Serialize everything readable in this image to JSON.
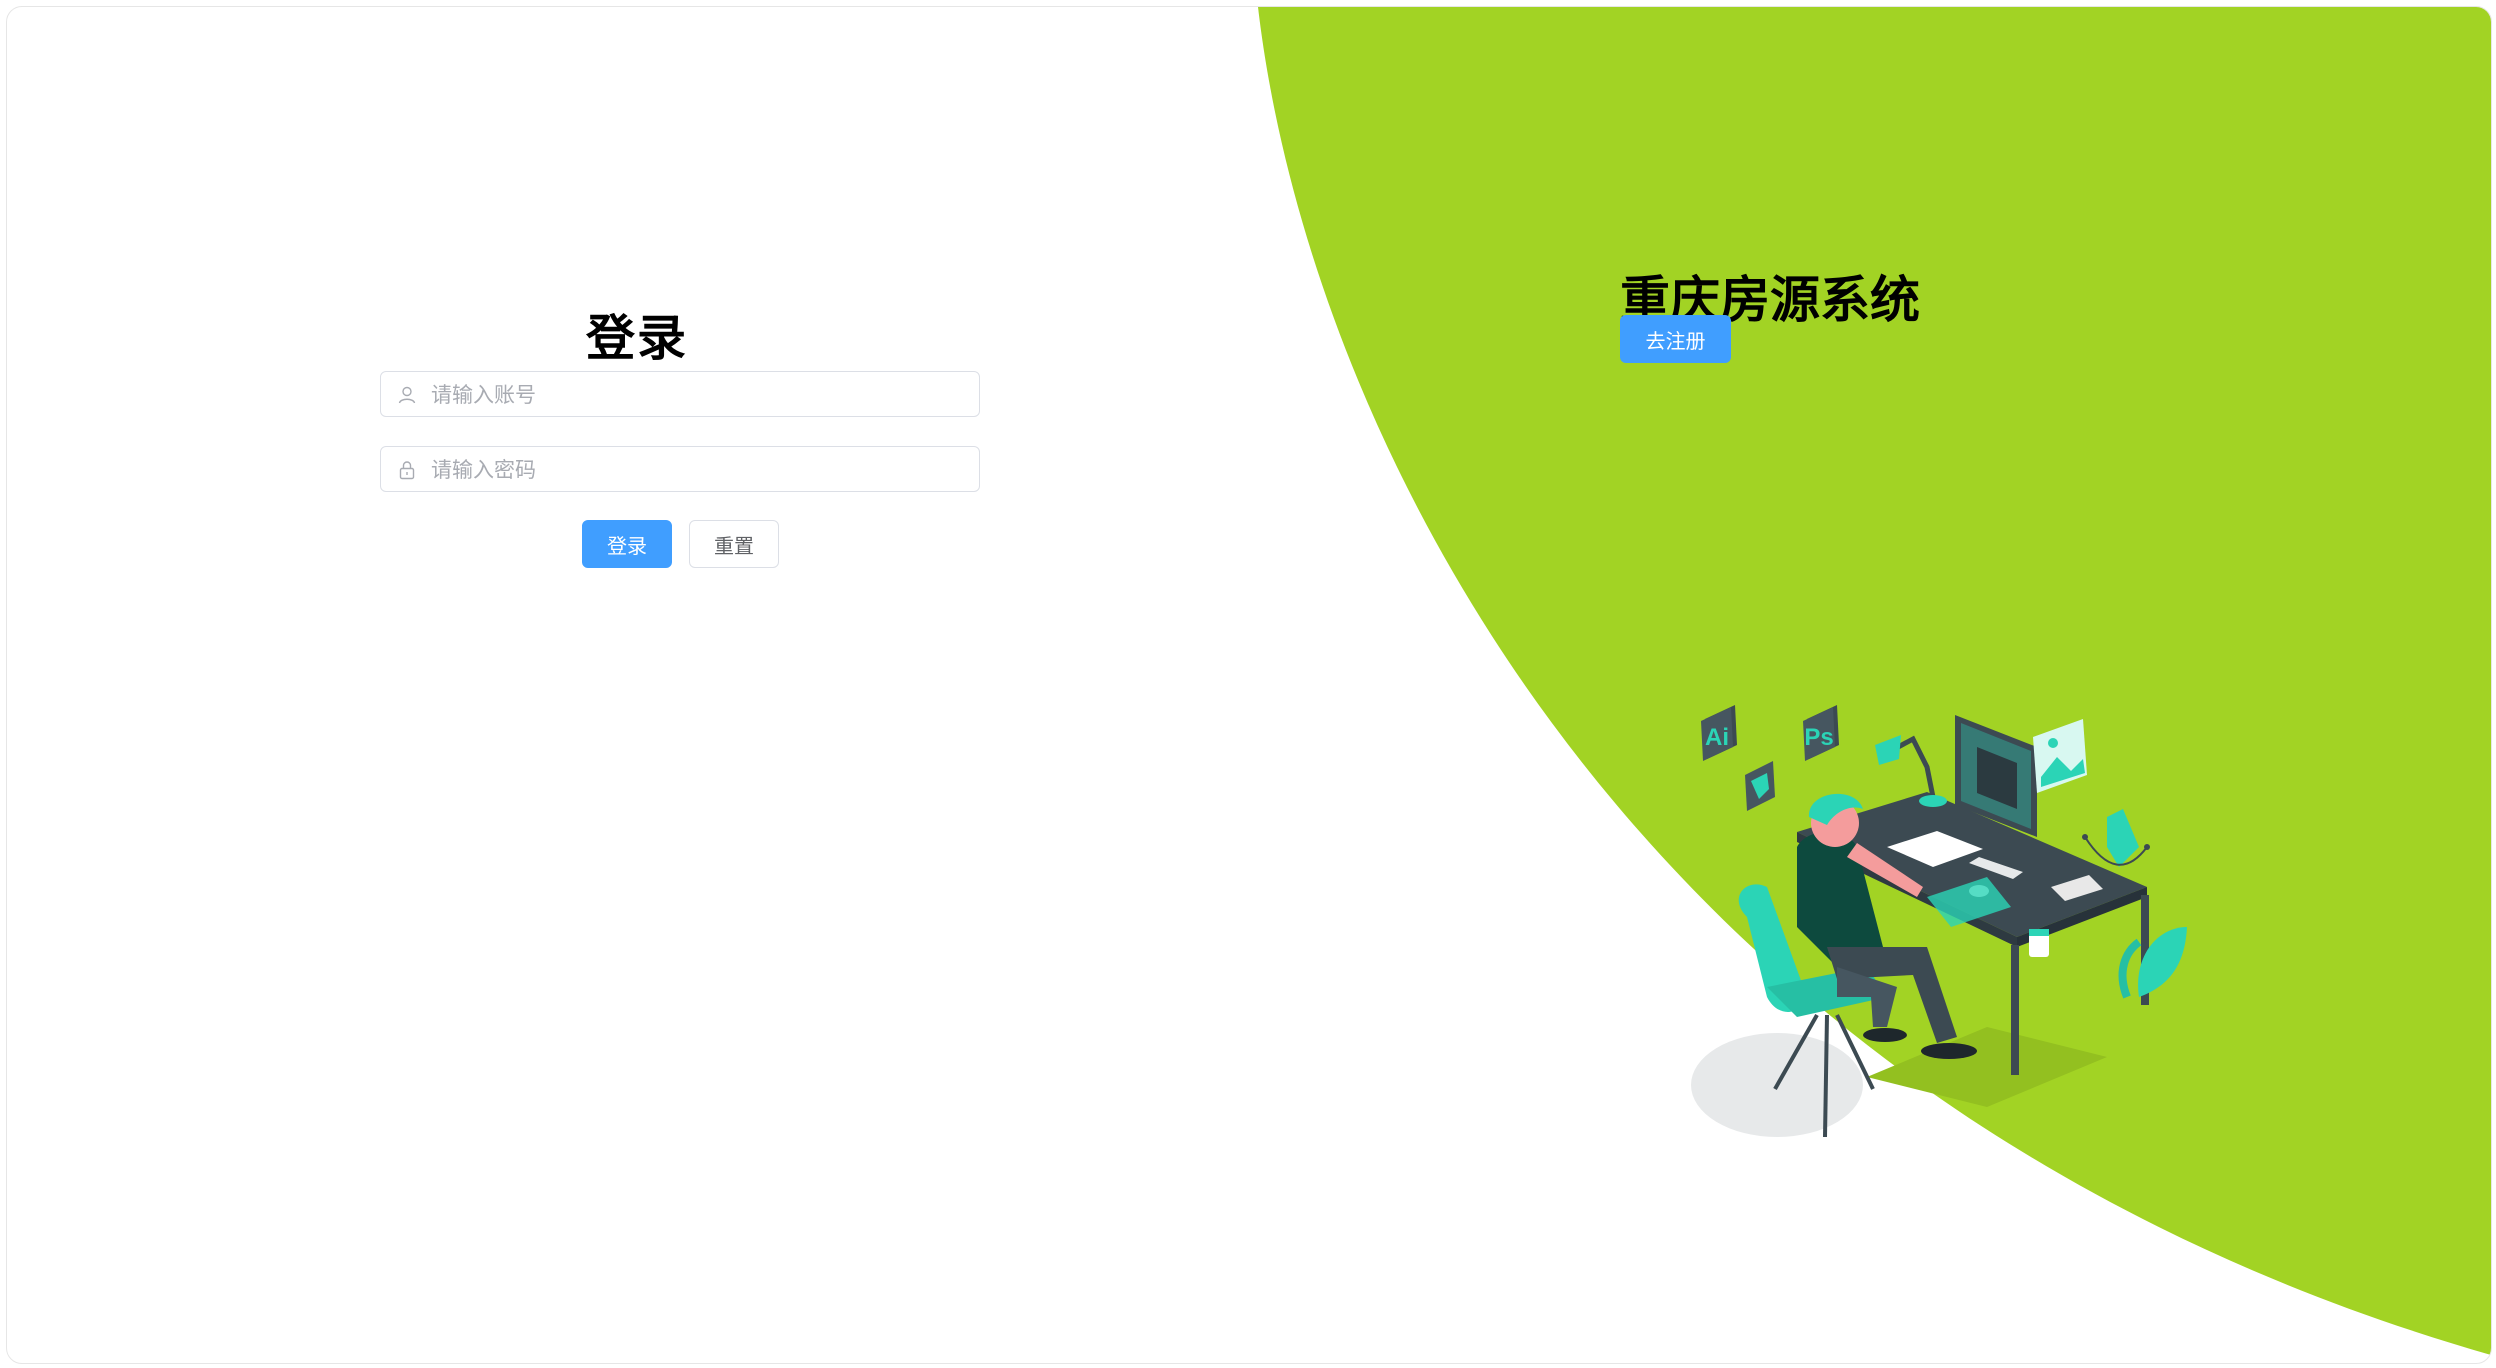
{
  "login": {
    "title": "登录",
    "username": {
      "placeholder": "请输入账号",
      "value": "",
      "icon": "user-icon"
    },
    "password": {
      "placeholder": "请输入密码",
      "value": "",
      "icon": "lock-icon"
    },
    "submit_label": "登录",
    "reset_label": "重置"
  },
  "register_panel": {
    "system_title": "重庆房源系统",
    "register_label": "去注册",
    "illustration": {
      "app_badges": [
        "Ai",
        "Ps"
      ],
      "icons": [
        "sketch-gem-icon",
        "desk-lamp-icon",
        "pen-tool-icon",
        "plant-icon"
      ]
    }
  },
  "colors": {
    "accent_green": "#a2d324",
    "button_blue": "#409eff",
    "teal": "#2bd4b6",
    "dark_slate": "#3c4a52"
  }
}
